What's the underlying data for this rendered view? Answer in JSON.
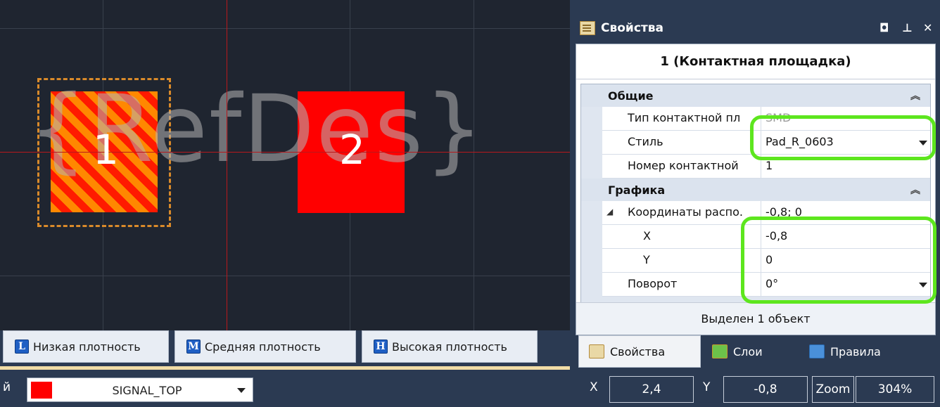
{
  "canvas": {
    "refdes_text": "{RefDes}",
    "pad1_label": "1",
    "pad2_label": "2",
    "pad_colors": {
      "pad1_stripe_a": "#ff8800",
      "pad1_stripe_b": "#ff1a00",
      "pad2": "#ff0000"
    }
  },
  "density_tabs": [
    {
      "icon_letter": "L",
      "label": "Низкая плотность"
    },
    {
      "icon_letter": "M",
      "label": "Средняя плотность"
    },
    {
      "icon_letter": "H",
      "label": "Высокая плотность"
    }
  ],
  "properties": {
    "title": "Свойства",
    "object_name": "1 (Контактная площадка)",
    "categories": {
      "general": {
        "label": "Общие",
        "rows": [
          {
            "name": "Тип контактной пл",
            "value": "SMD"
          },
          {
            "name": "Стиль",
            "value": "Pad_R_0603"
          },
          {
            "name": "Номер контактной",
            "value": "1"
          }
        ]
      },
      "graphics": {
        "label": "Графика",
        "rows": [
          {
            "name": "Координаты распо.",
            "value": "-0,8; 0"
          },
          {
            "name": "X",
            "value": "-0,8"
          },
          {
            "name": "Y",
            "value": "0"
          },
          {
            "name": "Поворот",
            "value": "0°"
          }
        ]
      }
    },
    "selection_status": "Выделен 1 объект",
    "tabs": [
      {
        "label": "Свойства",
        "icon": "properties-icon"
      },
      {
        "label": "Слои",
        "icon": "layers-icon"
      },
      {
        "label": "Правила",
        "icon": "rules-icon"
      }
    ],
    "highlight_color": "#5de61e"
  },
  "status_bar": {
    "left_fragment": "й",
    "layer_name": "SIGNAL_TOP",
    "layer_color": "#ff0000",
    "x_label": "X",
    "x_value": "2,4",
    "y_label": "Y",
    "y_value": "-0,8",
    "zoom_label": "Zoom",
    "zoom_value": "304%"
  }
}
